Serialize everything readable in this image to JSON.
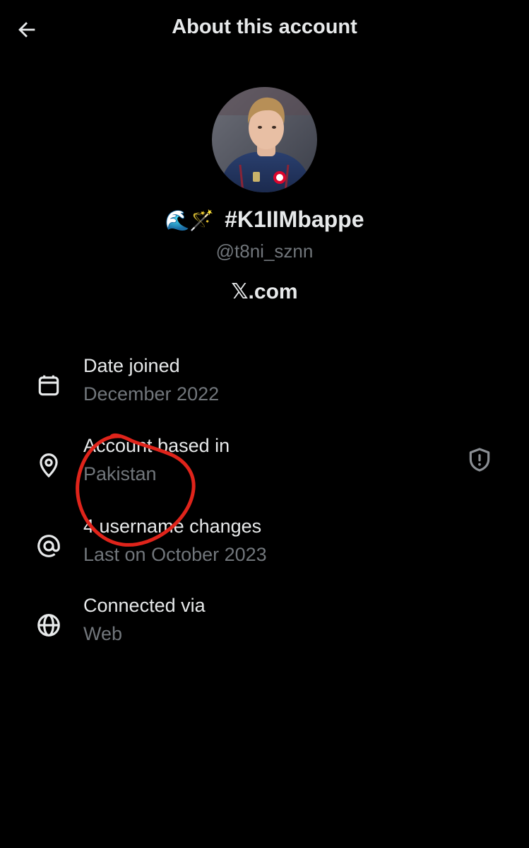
{
  "header": {
    "title": "About this account",
    "back_icon": "arrow-left-icon"
  },
  "profile": {
    "avatar": "profile-photo",
    "emoji_prefix": "🌊🪄",
    "display_name": "#K1IIMbappe",
    "handle": "@t8ni_sznn",
    "site": "𝕏.com"
  },
  "details": {
    "date_joined": {
      "icon": "calendar-icon",
      "label": "Date joined",
      "value": "December 2022"
    },
    "based_in": {
      "icon": "location-pin-icon",
      "label": "Account based in",
      "value": "Pakistan",
      "action_icon": "shield-alert-icon"
    },
    "username_changes": {
      "icon": "at-sign-icon",
      "label": "4 username changes",
      "value": "Last on October 2023"
    },
    "connected_via": {
      "icon": "globe-icon",
      "label": "Connected via",
      "value": "Web"
    }
  },
  "colors": {
    "background": "#000000",
    "primary_text": "#e7e9ea",
    "secondary_text": "#71767b",
    "annotation": "#e0241b"
  }
}
